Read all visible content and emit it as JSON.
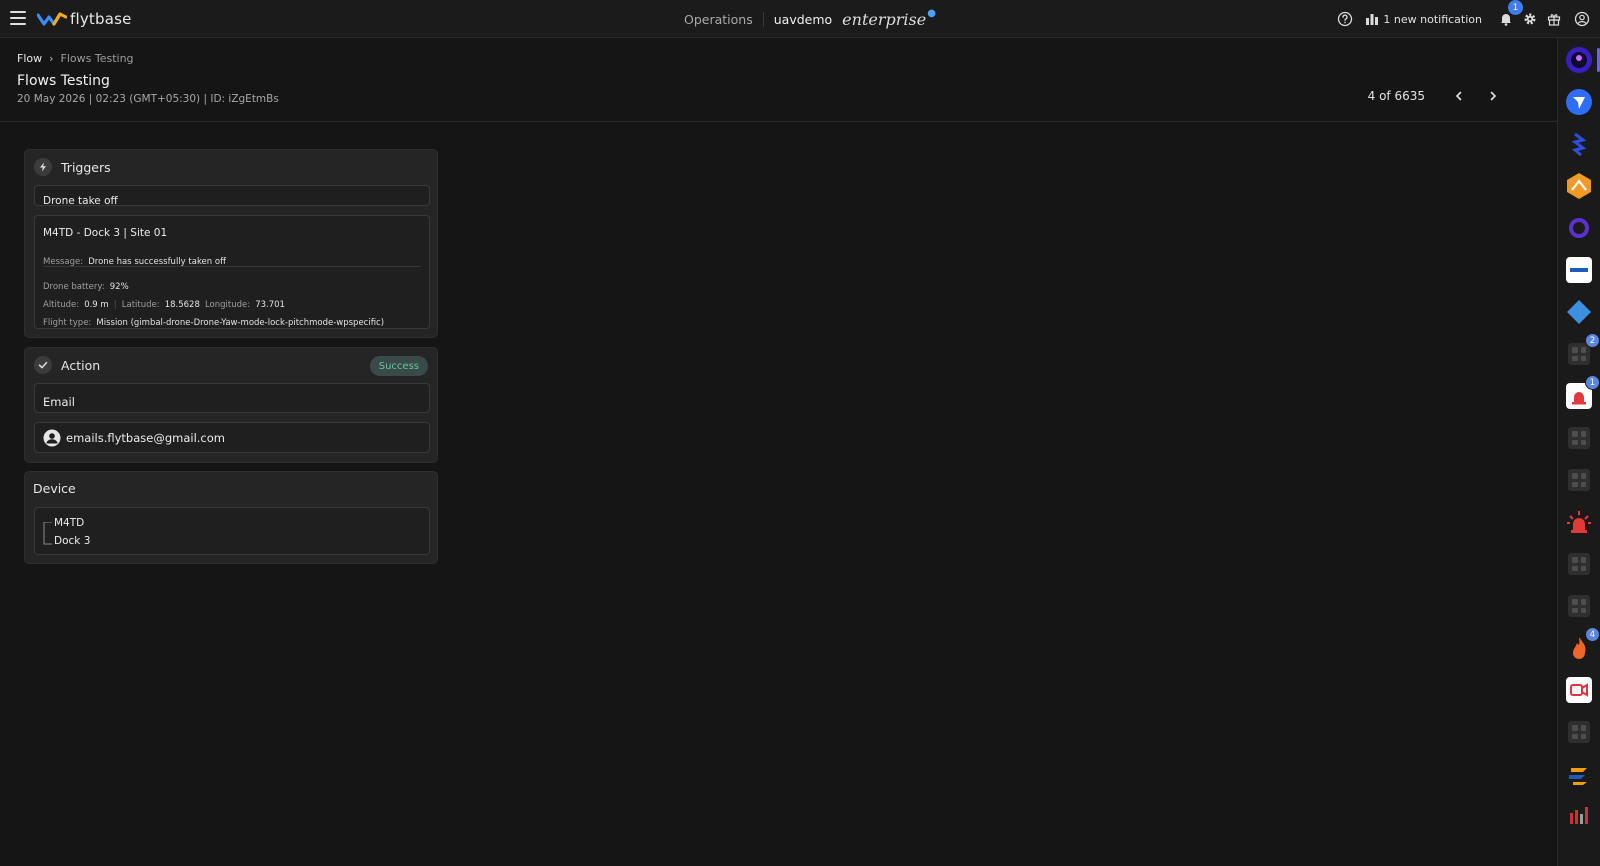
{
  "topbar": {
    "logo_text": "flytbase",
    "operations": "Operations",
    "org": "uavdemo",
    "plan": "enterprise",
    "notification_text": "1 new notification",
    "bell_badge": "1"
  },
  "breadcrumb": {
    "root": "Flow",
    "sep": "›",
    "current": "Flows Testing"
  },
  "header": {
    "title": "Flows Testing",
    "meta": "20 May 2026 | 02:23 (GMT+05:30) | ID: iZgEtmBs",
    "pager": "4 of 6635"
  },
  "triggers": {
    "title": "Triggers",
    "event": "Drone take off",
    "source": "M4TD - Dock 3 | Site 01",
    "message_label": "Message:",
    "message": "Drone has successfully taken off",
    "battery_label": "Drone battery:",
    "battery": "92%",
    "altitude_label": "Altitude:",
    "altitude": "0.9 m",
    "latitude_label": "Latitude:",
    "latitude": "18.5628",
    "longitude_label": "Longitude:",
    "longitude": "73.701",
    "flight_type_label": "Flight type:",
    "flight_type": "Mission (gimbal-drone-Drone-Yaw-mode-lock-pitchmode-wpspecific)"
  },
  "action": {
    "title": "Action",
    "status": "Success",
    "type": "Email",
    "recipient": "emails.flytbase@gmail.com"
  },
  "device": {
    "title": "Device",
    "drone": "M4TD",
    "dock": "Dock 3"
  },
  "rail": {
    "badges": {
      "b1": "2",
      "b2": "1",
      "b3": "4"
    }
  },
  "colors": {
    "background": "#151515",
    "card": "#252525",
    "accent": "#3d7eea",
    "success": "#5fc99a"
  }
}
